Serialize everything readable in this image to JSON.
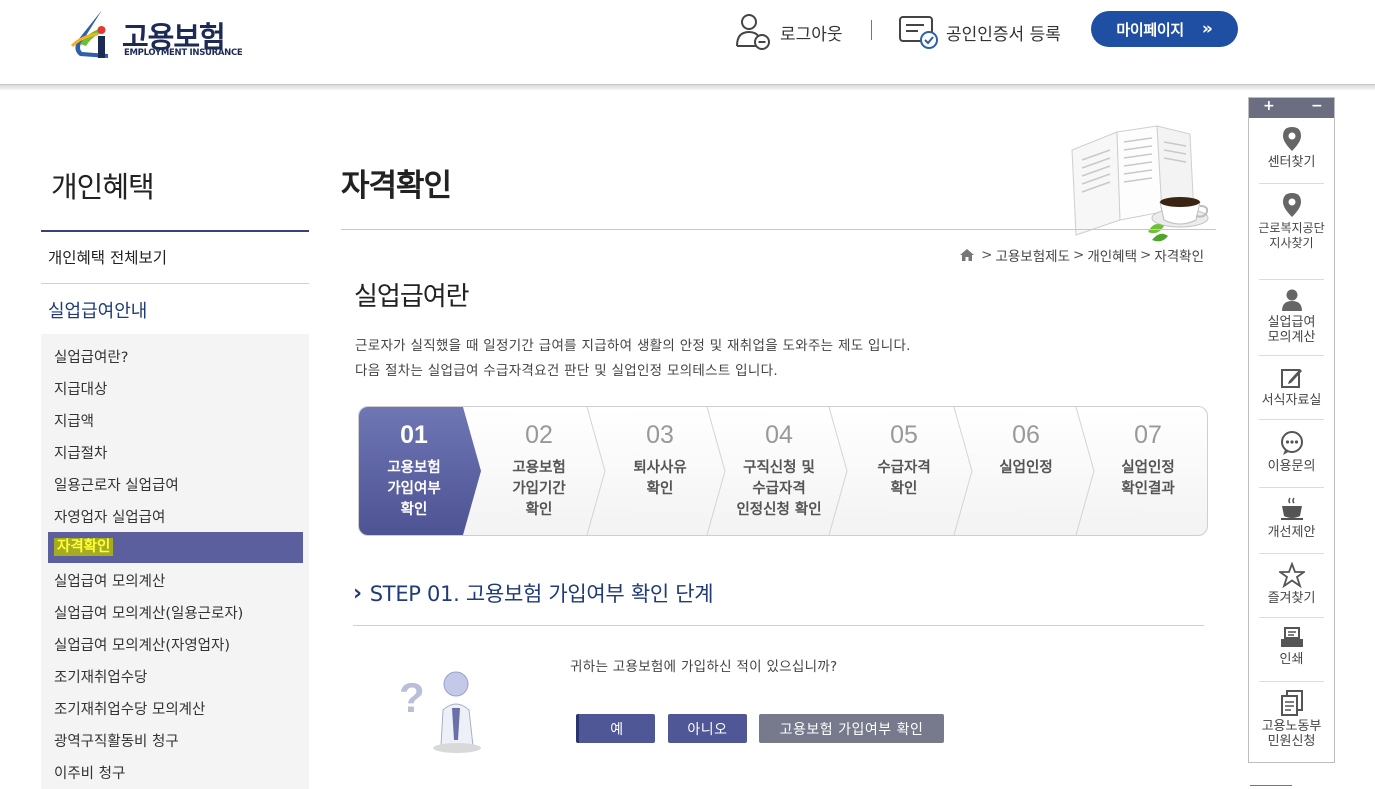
{
  "header": {
    "logo_title": "고용보험",
    "logo_sub": "EMPLOYMENT INSURANCE",
    "logout_label": "로그아웃",
    "cert_label": "공인인증서 등록",
    "mypage_label": "마이페이지",
    "mypage_chevron": "»"
  },
  "sidebar": {
    "title": "개인혜택",
    "all_label": "개인혜택 전체보기",
    "section_label": "실업급여안내",
    "items": [
      "실업급여란?",
      "지급대상",
      "지급액",
      "지급절차",
      "일용근로자 실업급여",
      "자영업자 실업급여",
      "자격확인",
      "실업급여 모의계산",
      "실업급여 모의계산(일용근로자)",
      "실업급여 모의계산(자영업자)",
      "조기재취업수당",
      "조기재취업수당 모의계산",
      "광역구직활동비 청구",
      "이주비 청구"
    ],
    "active_index": 6
  },
  "main": {
    "page_title": "자격확인",
    "breadcrumb": [
      "고용보험제도",
      "개인혜택",
      "자격확인"
    ],
    "breadcrumb_sep": ">",
    "sub_title": "실업급여란",
    "desc_line1": "근로자가 실직했을 때 일정기간 급여를 지급하여 생활의 안정 및 재취업을 도와주는 제도 입니다.",
    "desc_line2": "다음 절차는 실업급여 수급자격요건 판단 및 실업인정 모의테스트 입니다.",
    "steps": [
      {
        "num": "01",
        "lines": [
          "고용보험",
          "가입여부",
          "확인"
        ]
      },
      {
        "num": "02",
        "lines": [
          "고용보험",
          "가입기간",
          "확인"
        ]
      },
      {
        "num": "03",
        "lines": [
          "퇴사사유",
          "확인"
        ]
      },
      {
        "num": "04",
        "lines": [
          "구직신청 및",
          "수급자격",
          "인정신청 확인"
        ]
      },
      {
        "num": "05",
        "lines": [
          "수급자격",
          "확인"
        ]
      },
      {
        "num": "06",
        "lines": [
          "실업인정"
        ]
      },
      {
        "num": "07",
        "lines": [
          "실업인정",
          "확인결과"
        ]
      }
    ],
    "active_step": 0,
    "step_heading_mark": "›",
    "step_heading": "STEP 01. 고용보험 가입여부 확인 단계",
    "question": "귀하는 고용보험에 가입하신 적이 있으십니까?",
    "btn_yes": "예",
    "btn_no": "아니오",
    "btn_check": "고용보험 가입여부 확인"
  },
  "quick_menu": {
    "plus": "+",
    "minus": "−",
    "items": [
      {
        "label": "센터찾기",
        "icon": "map-pin-icon"
      },
      {
        "label": "근로복지공단 지사찾기",
        "icon": "map-pin-icon"
      },
      {
        "label": "실업급여 모의계산",
        "icon": "person-icon"
      },
      {
        "label": "서식자료실",
        "icon": "edit-icon"
      },
      {
        "label": "이용문의",
        "icon": "chat-icon"
      },
      {
        "label": "개선제안",
        "icon": "coffee-icon"
      },
      {
        "label": "즐겨찾기",
        "icon": "star-icon"
      },
      {
        "label": "인쇄",
        "icon": "print-icon"
      },
      {
        "label": "고용노동부 민원신청",
        "icon": "document-icon"
      }
    ]
  },
  "colors": {
    "brand_navy": "#1c2a55",
    "mypage_blue": "#1f4fa2",
    "active_nav": "#5c5f9d",
    "active_step": "#5d64a3"
  }
}
